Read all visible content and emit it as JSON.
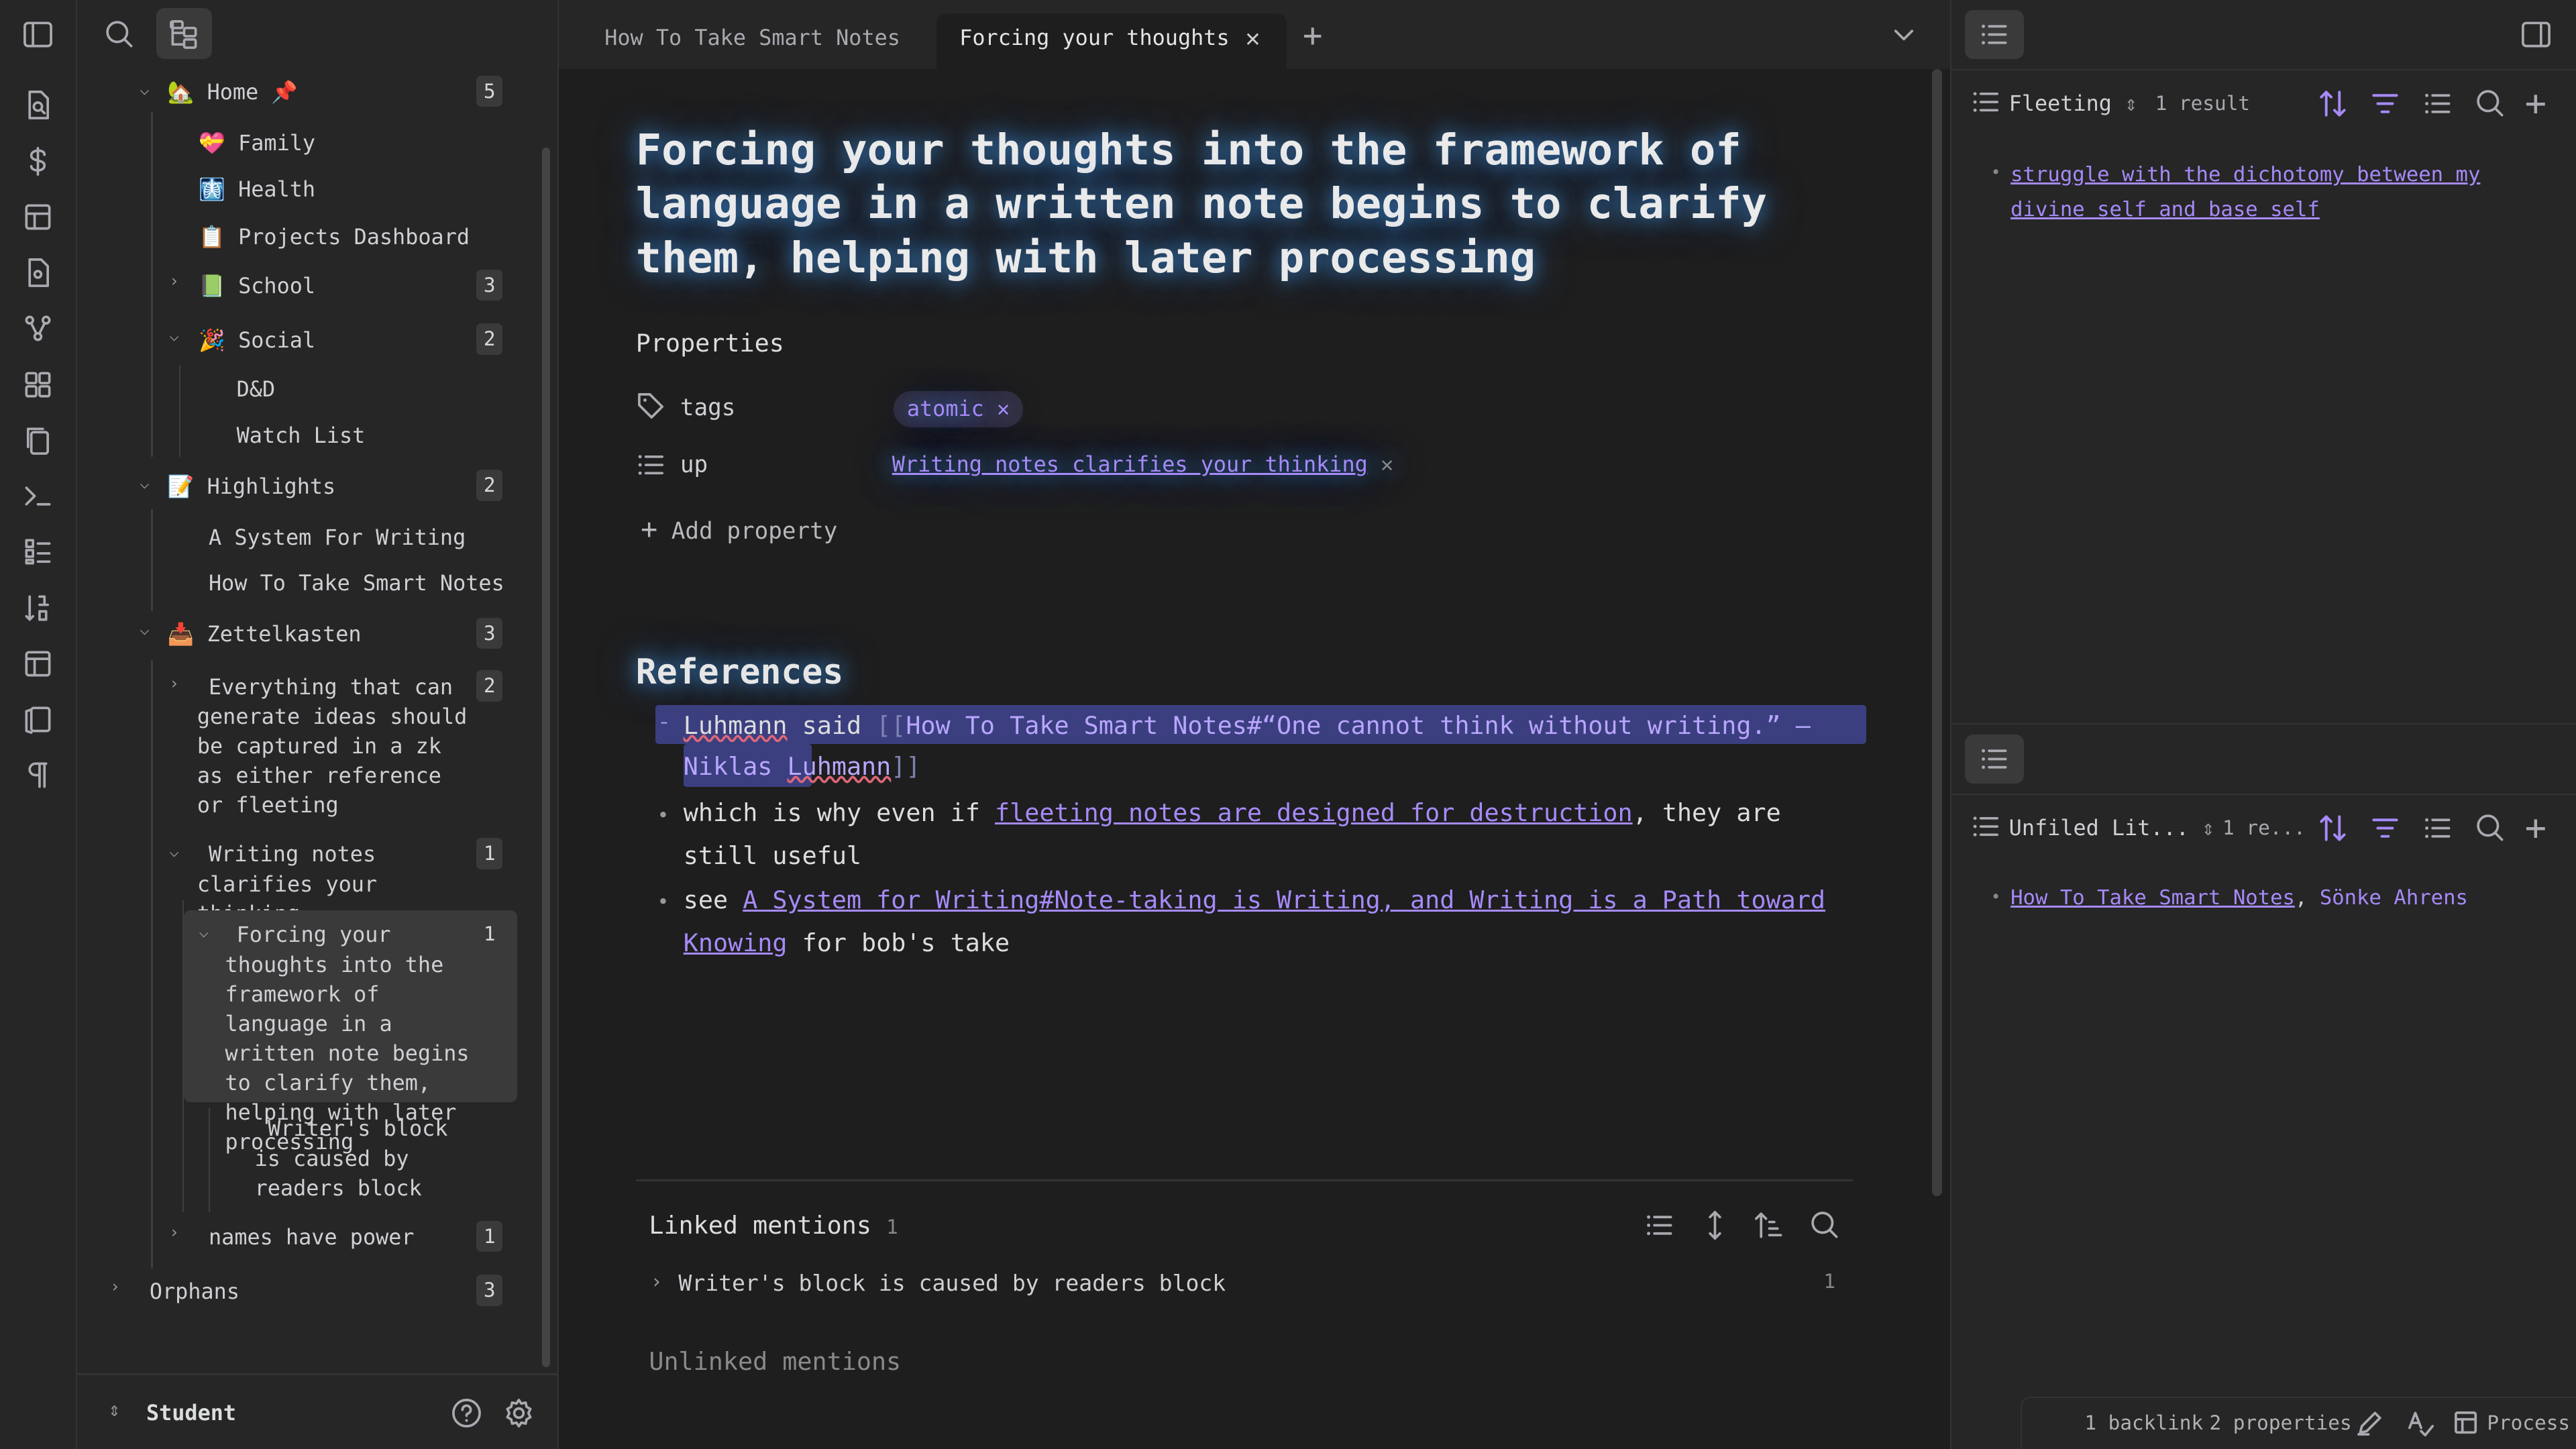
{
  "sidebar": {
    "tree": {
      "home": {
        "label": "Home 📌",
        "count": "5"
      },
      "family": "Family",
      "health": "Health",
      "projects": "Projects Dashboard",
      "school": {
        "label": "School",
        "count": "3"
      },
      "social": {
        "label": "Social",
        "count": "2"
      },
      "dnd": "D&D",
      "watchlist": "Watch List",
      "highlights": {
        "label": "Highlights",
        "count": "2"
      },
      "system": "A System For Writing",
      "smartnotes": "How To Take Smart Notes",
      "zettel": {
        "label": "Zettelkasten",
        "count": "3"
      },
      "everything": {
        "label": "Everything that can generate ideas should be captured in a zk as either reference or fleeting",
        "count": "2"
      },
      "writing": {
        "label": "Writing notes clarifies your thinking",
        "count": "1"
      },
      "forcing": {
        "label": "Forcing your thoughts into the framework of language in a written note begins to clarify them, helping with later processing",
        "count": "1"
      },
      "writers": "Writer's block is caused by readers block",
      "names": {
        "label": "names have power",
        "count": "1"
      },
      "orphans": {
        "label": "Orphans",
        "count": "3"
      }
    },
    "vault_name": "Student"
  },
  "tabs": [
    {
      "label": "How To Take Smart Notes"
    },
    {
      "label": "Forcing your thoughts i..."
    }
  ],
  "note": {
    "title": "Forcing your thoughts into the framework of language in a written note begins to clarify them, helping with later processing",
    "properties_heading": "Properties",
    "props": [
      {
        "key": "tags",
        "value": "atomic"
      },
      {
        "key": "up",
        "value": "Writing notes clarifies your thinking"
      }
    ],
    "add_property": "Add property",
    "references_heading": "References",
    "refs": {
      "r1_a": "Luhmann",
      "r1_b": " said ",
      "r1_c": "[[",
      "r1_d": "How To Take Smart Notes#“One cannot think without writing.” – Niklas ",
      "r1_e": "Luhmann",
      "r1_f": "]]",
      "r2_a": "which is why even if ",
      "r2_link": "fleeting notes are designed for destruction",
      "r2_b": ", they are still useful",
      "r3_a": "see ",
      "r3_link": "A System for Writing#Note-taking is Writing, and Writing is a Path toward Knowing",
      "r3_b": " for bob's take"
    },
    "linked_mentions": {
      "label": "Linked mentions",
      "count": "1",
      "item": "Writer's block is caused by readers block",
      "item_count": "1"
    },
    "unlinked_mentions": "Unlinked mentions"
  },
  "right_panel": {
    "top": {
      "name": "Fleeting",
      "results": "1 result",
      "item": "struggle with the dichotomy between my divine self and base self"
    },
    "bottom": {
      "name": "Unfiled Lit...",
      "results": "1 re...",
      "item_link": "How To Take Smart Notes",
      "item_sep": ", ",
      "item_author": "Sönke Ahrens"
    }
  },
  "status": {
    "backlinks": "1 backlink",
    "properties": "2 properties",
    "process": "Process"
  },
  "colors": {
    "accent": "#a68af9",
    "background": "#1e1e1e",
    "panel": "#262626"
  }
}
